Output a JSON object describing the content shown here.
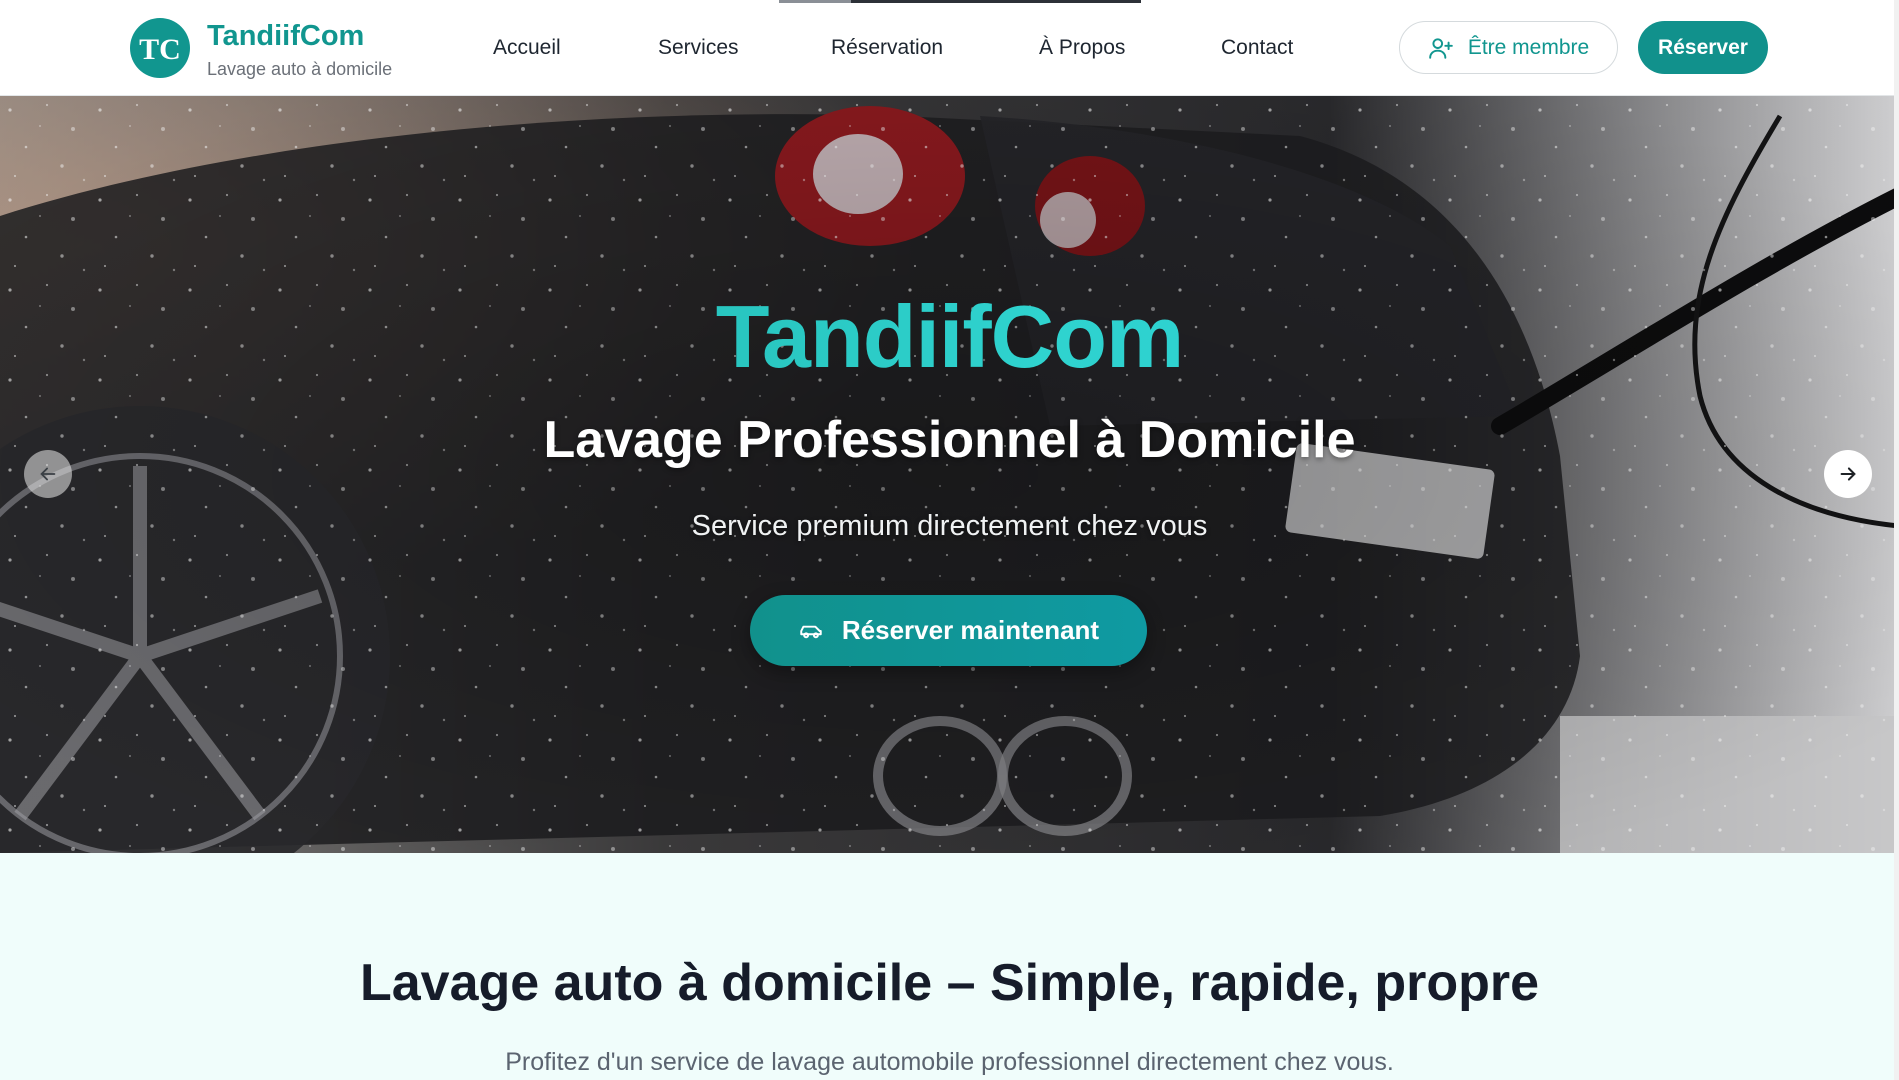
{
  "brand": {
    "name": "TandiifCom",
    "tagline": "Lavage auto à domicile",
    "logo_letters": "TC"
  },
  "nav": {
    "items": [
      {
        "label": "Accueil"
      },
      {
        "label": "Services"
      },
      {
        "label": "Réservation"
      },
      {
        "label": "À Propos"
      },
      {
        "label": "Contact"
      }
    ],
    "active": "Réservation"
  },
  "header_actions": {
    "member_label": "Être membre",
    "member_icon": "user-plus-icon",
    "reserve_label": "Réserver"
  },
  "hero": {
    "title": "TandiifCom",
    "subtitle": "Lavage Professionnel à Domicile",
    "tagline": "Service premium directement chez vous",
    "cta_label": "Réserver maintenant",
    "cta_icon": "car-icon",
    "prev_icon": "arrow-left-icon",
    "next_icon": "arrow-right-icon"
  },
  "intro": {
    "title": "Lavage auto à domicile – Simple, rapide, propre",
    "text": "Profitez d'un service de lavage automobile professionnel directement chez vous."
  },
  "colors": {
    "primary": "#11968f",
    "title_gradient_start": "#1aa79d",
    "title_gradient_end": "#2fd3cf",
    "section_background": "#f0fdfb",
    "text_dark": "#161c2a"
  }
}
